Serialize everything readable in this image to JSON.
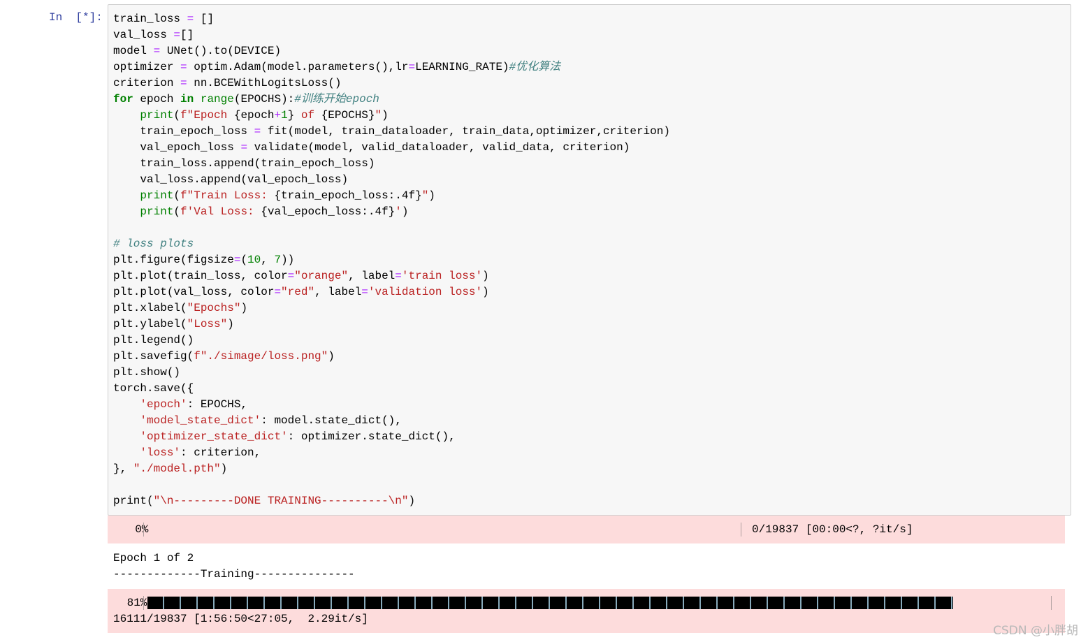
{
  "cell": {
    "prompt": "In  [*]:",
    "code_lines": [
      [
        [
          "train_loss ",
          ""
        ],
        [
          "=",
          "op"
        ],
        [
          " []",
          ""
        ]
      ],
      [
        [
          "val_loss ",
          ""
        ],
        [
          "=",
          "op"
        ],
        [
          "[]",
          ""
        ]
      ],
      [
        [
          "model ",
          ""
        ],
        [
          "=",
          "op"
        ],
        [
          " UNet().to(DEVICE)",
          ""
        ]
      ],
      [
        [
          "optimizer ",
          ""
        ],
        [
          "=",
          "op"
        ],
        [
          " optim.Adam(model.parameters(),lr",
          ""
        ],
        [
          "=",
          "op"
        ],
        [
          "LEARNING_RATE)",
          ""
        ],
        [
          "#优化算法",
          "cm"
        ]
      ],
      [
        [
          "criterion ",
          ""
        ],
        [
          "=",
          "op"
        ],
        [
          " nn.BCEWithLogitsLoss()",
          ""
        ]
      ],
      [
        [
          "for",
          "kw"
        ],
        [
          " epoch ",
          ""
        ],
        [
          "in",
          "kw"
        ],
        [
          " ",
          ""
        ],
        [
          "range",
          "bi"
        ],
        [
          "(EPOCHS):",
          ""
        ],
        [
          "#训练开始epoch",
          "cm"
        ]
      ],
      [
        [
          "    ",
          ""
        ],
        [
          "print",
          "bi"
        ],
        [
          "(",
          ""
        ],
        [
          "f\"Epoch ",
          "st"
        ],
        [
          "{epoch",
          ""
        ],
        [
          "+",
          "op"
        ],
        [
          "1",
          "nu"
        ],
        [
          "}",
          ""
        ],
        [
          " of ",
          "st"
        ],
        [
          "{EPOCHS}",
          ""
        ],
        [
          "\"",
          "st"
        ],
        [
          ")",
          ""
        ]
      ],
      [
        [
          "    train_epoch_loss ",
          ""
        ],
        [
          "=",
          "op"
        ],
        [
          " fit(model, train_dataloader, train_data,optimizer,criterion)",
          ""
        ]
      ],
      [
        [
          "    val_epoch_loss ",
          ""
        ],
        [
          "=",
          "op"
        ],
        [
          " validate(model, valid_dataloader, valid_data, criterion)",
          ""
        ]
      ],
      [
        [
          "    train_loss.append(train_epoch_loss)",
          ""
        ]
      ],
      [
        [
          "    val_loss.append(val_epoch_loss)",
          ""
        ]
      ],
      [
        [
          "    ",
          ""
        ],
        [
          "print",
          "bi"
        ],
        [
          "(",
          ""
        ],
        [
          "f\"Train Loss: ",
          "st"
        ],
        [
          "{train_epoch_loss:.4f}",
          ""
        ],
        [
          "\"",
          "st"
        ],
        [
          ")",
          ""
        ]
      ],
      [
        [
          "    ",
          ""
        ],
        [
          "print",
          "bi"
        ],
        [
          "(",
          ""
        ],
        [
          "f'Val Loss: ",
          "st"
        ],
        [
          "{val_epoch_loss:.4f}",
          ""
        ],
        [
          "'",
          "st"
        ],
        [
          ")",
          ""
        ]
      ],
      [],
      [
        [
          "# loss plots",
          "cm"
        ]
      ],
      [
        [
          "plt.figure(figsize",
          ""
        ],
        [
          "=",
          "op"
        ],
        [
          "(",
          ""
        ],
        [
          "10",
          "nu"
        ],
        [
          ", ",
          ""
        ],
        [
          "7",
          "nu"
        ],
        [
          "))",
          ""
        ]
      ],
      [
        [
          "plt.plot(train_loss, color",
          ""
        ],
        [
          "=",
          "op"
        ],
        [
          "\"orange\"",
          "st"
        ],
        [
          ", label",
          ""
        ],
        [
          "=",
          "op"
        ],
        [
          "'train loss'",
          "st"
        ],
        [
          ")",
          ""
        ]
      ],
      [
        [
          "plt.plot(val_loss, color",
          ""
        ],
        [
          "=",
          "op"
        ],
        [
          "\"red\"",
          "st"
        ],
        [
          ", label",
          ""
        ],
        [
          "=",
          "op"
        ],
        [
          "'validation loss'",
          "st"
        ],
        [
          ")",
          ""
        ]
      ],
      [
        [
          "plt.xlabel(",
          ""
        ],
        [
          "\"Epochs\"",
          "st"
        ],
        [
          ")",
          ""
        ]
      ],
      [
        [
          "plt.ylabel(",
          ""
        ],
        [
          "\"Loss\"",
          "st"
        ],
        [
          ")",
          ""
        ]
      ],
      [
        [
          "plt.legend()",
          ""
        ]
      ],
      [
        [
          "plt.savefig(",
          ""
        ],
        [
          "f\"./simage/loss.png\"",
          "st"
        ],
        [
          ")",
          ""
        ]
      ],
      [
        [
          "plt.show()",
          ""
        ]
      ],
      [
        [
          "torch.save({",
          ""
        ]
      ],
      [
        [
          "    ",
          ""
        ],
        [
          "'epoch'",
          "st"
        ],
        [
          ": EPOCHS,",
          ""
        ]
      ],
      [
        [
          "    ",
          ""
        ],
        [
          "'model_state_dict'",
          "st"
        ],
        [
          ": model.state_dict(),",
          ""
        ]
      ],
      [
        [
          "    ",
          ""
        ],
        [
          "'optimizer_state_dict'",
          "st"
        ],
        [
          ": optimizer.state_dict(),",
          ""
        ]
      ],
      [
        [
          "    ",
          ""
        ],
        [
          "'loss'",
          "st"
        ],
        [
          ": criterion,",
          ""
        ]
      ],
      [
        [
          "}, ",
          ""
        ],
        [
          "\"./model.pth\"",
          "st"
        ],
        [
          ")",
          ""
        ]
      ],
      [],
      [
        [
          "print(",
          ""
        ],
        [
          "\"\\n---------DONE TRAINING----------\\n\"",
          "st"
        ],
        [
          ")",
          ""
        ]
      ]
    ]
  },
  "output": {
    "progress1": {
      "percent_label": "  0%",
      "percent": 0,
      "stats": "0/19837 [00:00<?, ?it/s]"
    },
    "epoch_text": "Epoch 1 of 2",
    "training_text": "-------------Training---------------",
    "progress2": {
      "percent_label": " 81%",
      "percent": 81,
      "stats": "16111/19837 [1:56:50<27:05,  2.29it/s]"
    },
    "bar_color": "#000000",
    "background_color": "#fddcdc"
  },
  "watermark": "CSDN @小胖胡"
}
